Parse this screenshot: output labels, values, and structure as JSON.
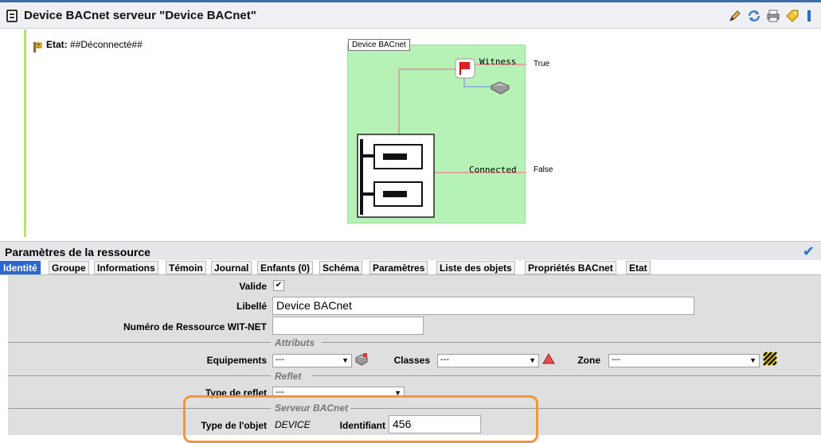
{
  "header": {
    "title": "Device BACnet serveur \"Device BACnet\""
  },
  "state": {
    "label": "Etat:",
    "value": "##Déconnecté##"
  },
  "diagram": {
    "device_label": "Device BACnet",
    "witness_label": "Witness",
    "witness_value": "True",
    "connected_label": "Connected",
    "connected_value": "False"
  },
  "params": {
    "title": "Paramètres de la ressource",
    "tabs": [
      "Identité",
      "Groupe",
      "Informations",
      "Témoin",
      "Journal",
      "Enfants (0)",
      "Schéma",
      "Paramètres",
      "Liste des objets",
      "Propriétés BACnet",
      "Etat"
    ],
    "valide_label": "Valide",
    "libelle_label": "Libellé",
    "libelle_value": "Device BACnet",
    "num_label": "Numéro de Ressource WIT-NET",
    "num_value": "",
    "attributs_title": "Attributs",
    "equipements_label": "Equipements",
    "equipements_value": "---",
    "classes_label": "Classes",
    "classes_value": "---",
    "zone_label": "Zone",
    "zone_value": "---",
    "reflet_title": "Reflet",
    "type_reflet_label": "Type de reflet",
    "type_reflet_value": "---",
    "serveur_title": "Serveur BACnet",
    "type_objet_label": "Type de l'objet",
    "type_objet_value": "DEVICE",
    "identifiant_label": "Identifiant",
    "identifiant_value": "456"
  },
  "colors": {
    "accent": "#2d66d0",
    "diagram_bg": "#b6f2b6",
    "highlight": "#f0963c"
  }
}
